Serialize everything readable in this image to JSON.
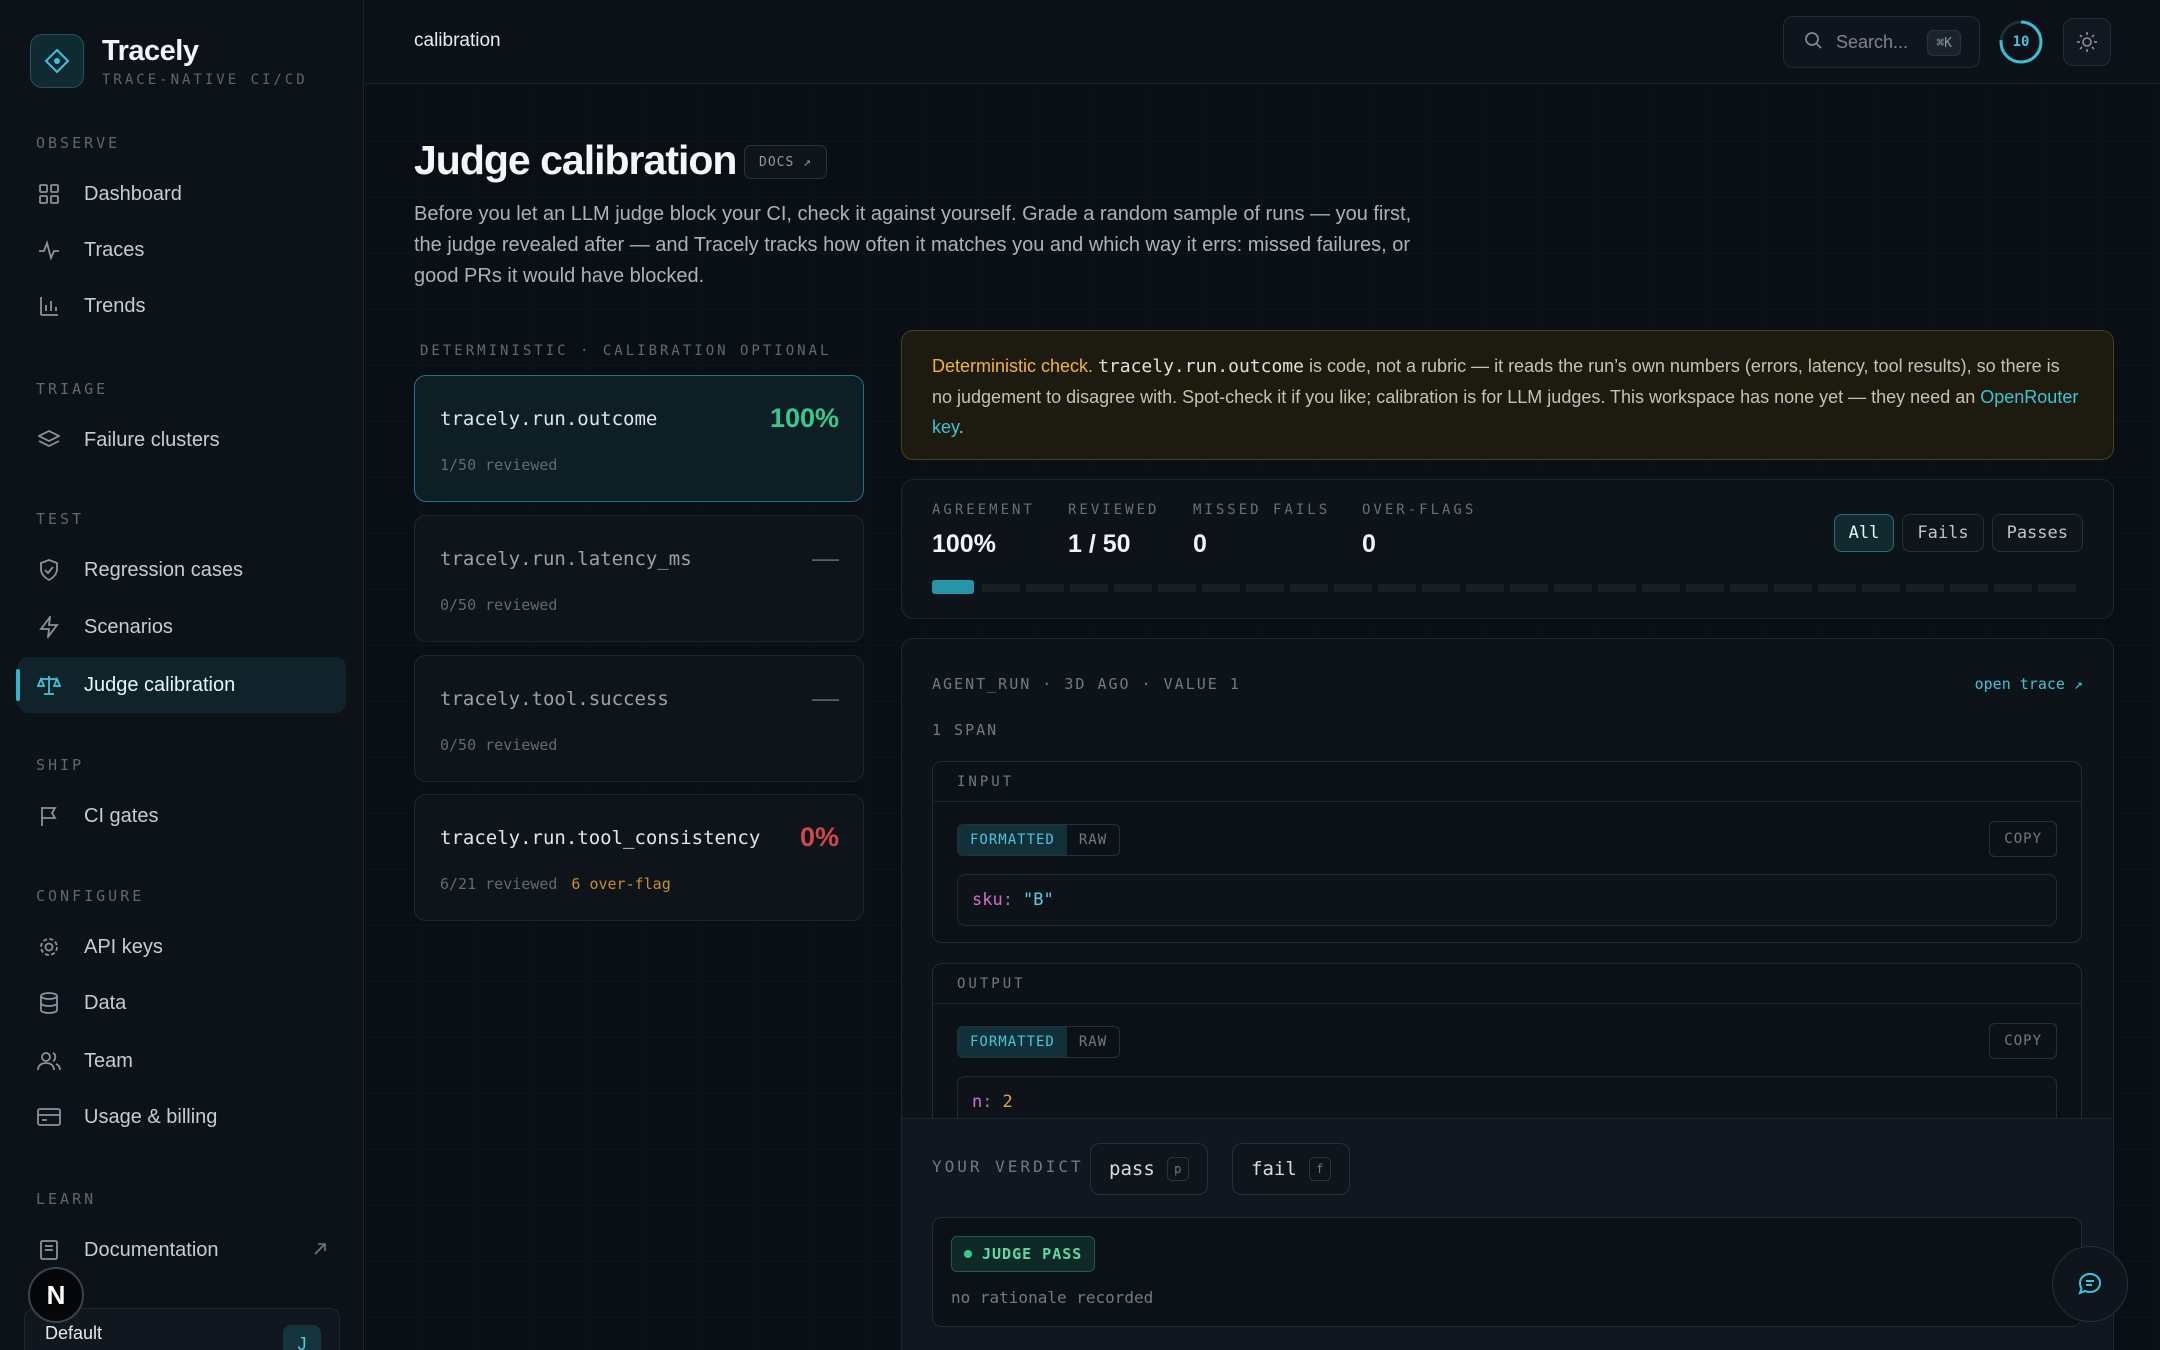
{
  "brand": {
    "name": "Tracely",
    "tagline": "TRACE-NATIVE CI/CD"
  },
  "sidebar": {
    "sections": [
      {
        "heading": "OBSERVE",
        "items": [
          {
            "label": "Dashboard",
            "icon": "grid-icon"
          },
          {
            "label": "Traces",
            "icon": "activity-icon"
          },
          {
            "label": "Trends",
            "icon": "bar-chart-icon"
          }
        ]
      },
      {
        "heading": "TRIAGE",
        "items": [
          {
            "label": "Failure clusters",
            "icon": "layers-icon"
          }
        ]
      },
      {
        "heading": "TEST",
        "items": [
          {
            "label": "Regression cases",
            "icon": "shield-check-icon"
          },
          {
            "label": "Scenarios",
            "icon": "zap-icon"
          },
          {
            "label": "Judge calibration",
            "icon": "scale-icon",
            "active": true
          }
        ]
      },
      {
        "heading": "SHIP",
        "items": [
          {
            "label": "CI gates",
            "icon": "flag-icon"
          }
        ]
      },
      {
        "heading": "CONFIGURE",
        "items": [
          {
            "label": "API keys",
            "icon": "gear-icon"
          },
          {
            "label": "Data",
            "icon": "database-icon"
          },
          {
            "label": "Team",
            "icon": "users-icon"
          },
          {
            "label": "Usage & billing",
            "icon": "credit-card-icon"
          }
        ]
      },
      {
        "heading": "LEARN",
        "items": [
          {
            "label": "Documentation",
            "icon": "book-icon",
            "external": true
          }
        ]
      }
    ],
    "workspace": {
      "name": "Default",
      "avatar": "J"
    },
    "n_badge": "N"
  },
  "topbar": {
    "breadcrumb": "calibration",
    "search_placeholder": "Search...",
    "search_shortcut": "⌘K",
    "notification_count": "10"
  },
  "page": {
    "title": "Judge calibration",
    "docs_label": "DOCS ↗",
    "intro": "Before you let an LLM judge block your CI, check it against yourself. Grade a random sample of runs — you first, the judge revealed after — and Tracely tracks how often it matches you and which way it errs: missed failures, or good PRs it would have blocked."
  },
  "judges": {
    "heading": "DETERMINISTIC · CALIBRATION OPTIONAL",
    "items": [
      {
        "name": "tracely.run.outcome",
        "score": "100%",
        "reviewed": "1/50 reviewed",
        "over_flag": "",
        "tone": "green",
        "selected": true
      },
      {
        "name": "tracely.run.latency_ms",
        "score": "—",
        "reviewed": "0/50 reviewed",
        "over_flag": "",
        "tone": "dash",
        "selected": false
      },
      {
        "name": "tracely.tool.success",
        "score": "—",
        "reviewed": "0/50 reviewed",
        "over_flag": "",
        "tone": "dash",
        "selected": false
      },
      {
        "name": "tracely.run.tool_consistency",
        "score": "0%",
        "reviewed": "6/21 reviewed",
        "over_flag": "6 over-flag",
        "tone": "red",
        "selected": false
      }
    ]
  },
  "banner": {
    "lead": "Deterministic check.",
    "code": "tracely.run.outcome",
    "body": "is code, not a rubric — it reads the run’s own numbers (errors, latency, tool results), so there is no judgement to disagree with. Spot-check it if you like; calibration is for LLM judges. This workspace has none yet — they need an",
    "link": "OpenRouter key",
    "tail": "."
  },
  "stats": {
    "agreement_label": "AGREEMENT",
    "agreement": "100%",
    "reviewed_label": "REVIEWED",
    "reviewed": "1 / 50",
    "missed_label": "MISSED FAILS",
    "missed": "0",
    "over_label": "OVER-FLAGS",
    "over": "0",
    "progress_fraction": 0.02,
    "filters": [
      "All",
      "Fails",
      "Passes"
    ],
    "active_filter": "All"
  },
  "detail": {
    "meta": "AGENT_RUN · 3D AGO · VALUE 1",
    "open_trace": "open trace ↗",
    "span_count": "1 SPAN",
    "input": {
      "heading": "INPUT",
      "formatted": "FORMATTED",
      "raw": "RAW",
      "copy": "COPY",
      "key": "sku",
      "value": "\"B\""
    },
    "output": {
      "heading": "OUTPUT",
      "formatted": "FORMATTED",
      "raw": "RAW",
      "copy": "COPY",
      "key": "n",
      "value": "2"
    }
  },
  "verdict": {
    "label": "YOUR VERDICT",
    "pass": "pass",
    "pass_key": "p",
    "fail": "fail",
    "fail_key": "f",
    "judge_label": "JUDGE PASS",
    "rationale": "no rationale recorded"
  },
  "colors": {
    "accent": "#2fb6cc",
    "success": "#35c98c",
    "danger": "#d2474f",
    "warning": "#f0b43c"
  }
}
